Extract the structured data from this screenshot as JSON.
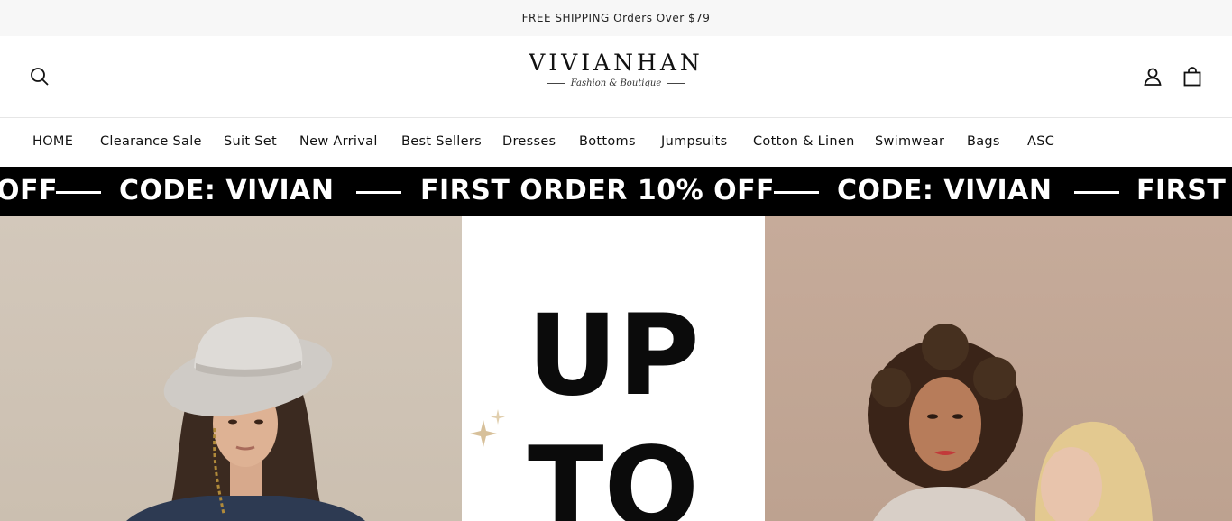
{
  "announcement": {
    "text": "FREE SHIPPING Orders Over $79"
  },
  "header": {
    "logo": {
      "name": "VIVIANHAN",
      "tagline": "Fashion & Boutique"
    },
    "icons": {
      "search": "search-icon",
      "account": "user-icon",
      "cart": "shopping-bag-icon"
    }
  },
  "nav": {
    "items": [
      {
        "label": "HOME"
      },
      {
        "label": "Clearance Sale"
      },
      {
        "label": "Suit Set"
      },
      {
        "label": "New Arrival"
      },
      {
        "label": "Best Sellers"
      },
      {
        "label": "Dresses"
      },
      {
        "label": "Bottoms"
      },
      {
        "label": "Jumpsuits"
      },
      {
        "label": "Cotton & Linen"
      },
      {
        "label": "Swimwear"
      },
      {
        "label": "Bags"
      },
      {
        "label": "ASC"
      }
    ]
  },
  "marquee": {
    "items": [
      "OFF",
      "CODE: VIVIAN",
      "FIRST ORDER 10% OFF",
      "CODE: VIVIAN",
      "FIRST O"
    ]
  },
  "hero": {
    "headline_line1": "UP",
    "headline_line2": "TO"
  },
  "colors": {
    "marquee_bg": "#000000",
    "left_panel": "#d3c8bb",
    "right_panel": "#c6ab9a",
    "accent_gold": "#c9a877"
  }
}
